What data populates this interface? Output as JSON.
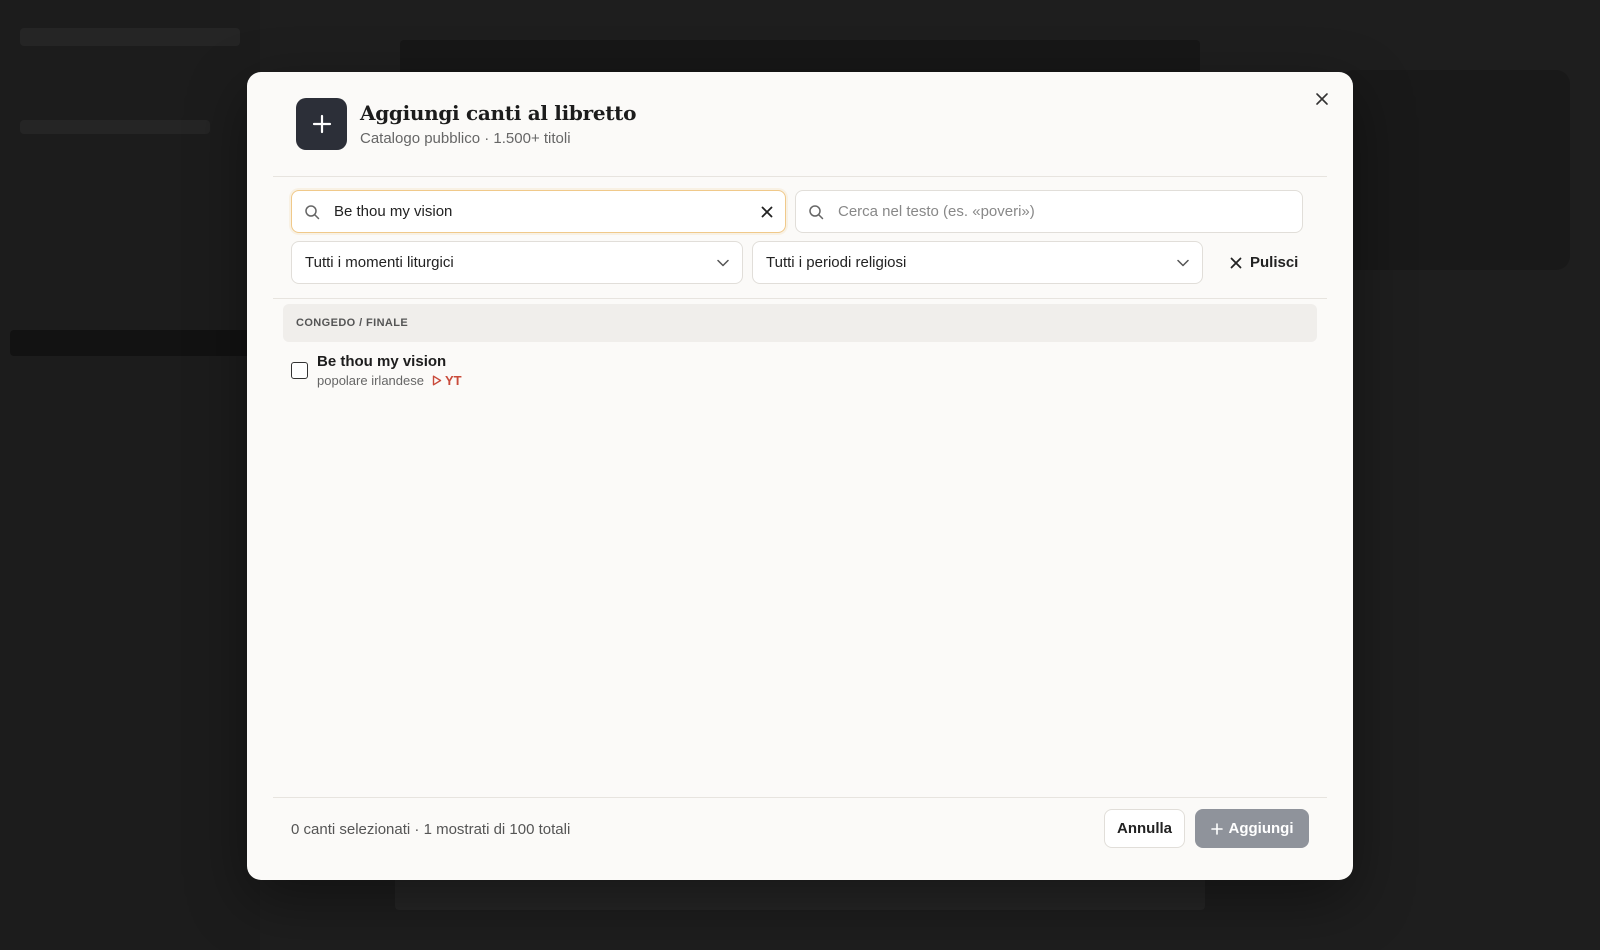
{
  "modal": {
    "title": "Aggiungi canti al libretto",
    "subtitle": "Catalogo pubblico · 1.500+ titoli"
  },
  "search": {
    "title_value": "Be thou my vision",
    "text_placeholder": "Cerca nel testo (es. «poveri»)"
  },
  "filters": {
    "moment_selected": "Tutti i momenti liturgici",
    "period_selected": "Tutti i periodi religiosi",
    "clear_label": "Pulisci"
  },
  "results": {
    "groups": [
      {
        "label": "CONGEDO / FINALE",
        "songs": [
          {
            "title": "Be thou my vision",
            "origin": "popolare irlandese",
            "media": "YT",
            "checked": false
          }
        ]
      }
    ]
  },
  "footer": {
    "status": "0 canti selezionati · 1 mostrati di 100 totali",
    "cancel_label": "Annulla",
    "add_label": "Aggiungi"
  },
  "colors": {
    "header_icon_bg": "#2c2f38",
    "active_border": "#f0c98a",
    "yt_accent": "#c94a3a",
    "add_button_disabled": "#8f939b"
  }
}
